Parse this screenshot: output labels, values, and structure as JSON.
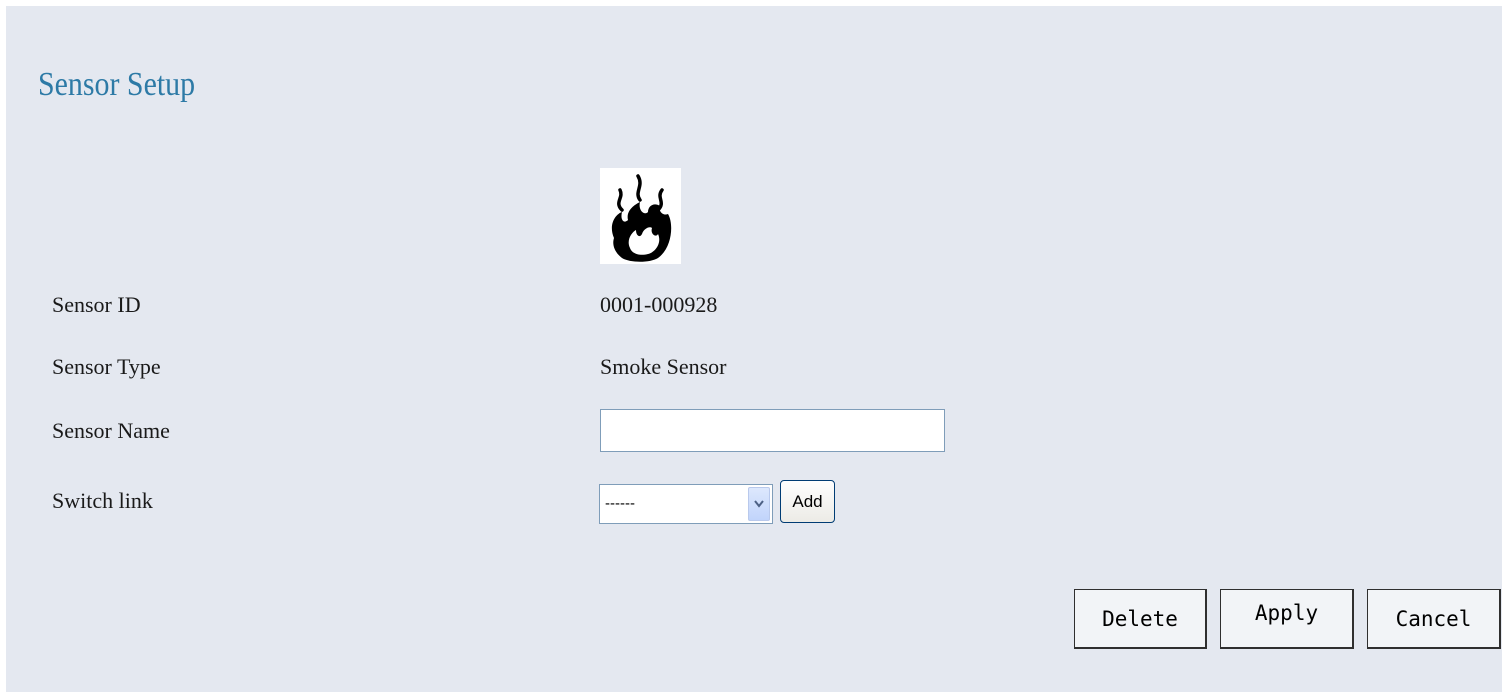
{
  "page": {
    "title": "Sensor Setup"
  },
  "sensor_image": {
    "icon": "flame-icon"
  },
  "fields": {
    "sensor_id": {
      "label": "Sensor ID",
      "value": "0001-000928"
    },
    "sensor_type": {
      "label": "Sensor Type",
      "value": "Smoke Sensor"
    },
    "sensor_name": {
      "label": "Sensor Name",
      "value": "",
      "placeholder": ""
    },
    "switch_link": {
      "label": "Switch link",
      "selected": "------",
      "add_label": "Add"
    }
  },
  "actions": {
    "delete_label": "Delete",
    "apply_label": "Apply",
    "cancel_label": "Cancel"
  },
  "colors": {
    "background": "#e4e8f0",
    "title": "#2d7aa6"
  }
}
